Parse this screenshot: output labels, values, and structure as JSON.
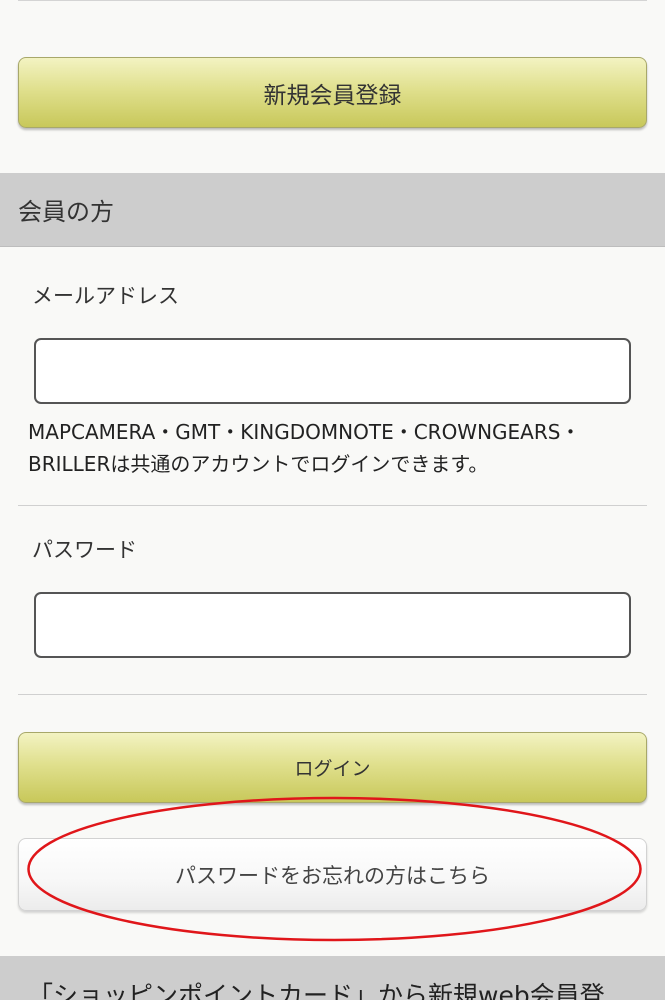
{
  "register": {
    "label": "新規会員登録"
  },
  "member_section": {
    "title": "会員の方"
  },
  "email": {
    "label": "メールアドレス",
    "value": "",
    "placeholder": ""
  },
  "note": {
    "line1": "MAPCAMERA・GMT・KINGDOMNOTE・CROWNGEARS・",
    "line2": "BRILLERは共通のアカウントでログインできます。"
  },
  "password": {
    "label": "パスワード",
    "value": "",
    "placeholder": ""
  },
  "login": {
    "label": "ログイン"
  },
  "forgot": {
    "label": "パスワードをお忘れの方はこちら"
  },
  "footer_band": {
    "text": "「ショッピンポイントカード」から新規web会員登"
  },
  "colors": {
    "button_green": "#d8d87c",
    "section_gray": "#cdcdcd",
    "highlight_red": "#e0161a"
  }
}
